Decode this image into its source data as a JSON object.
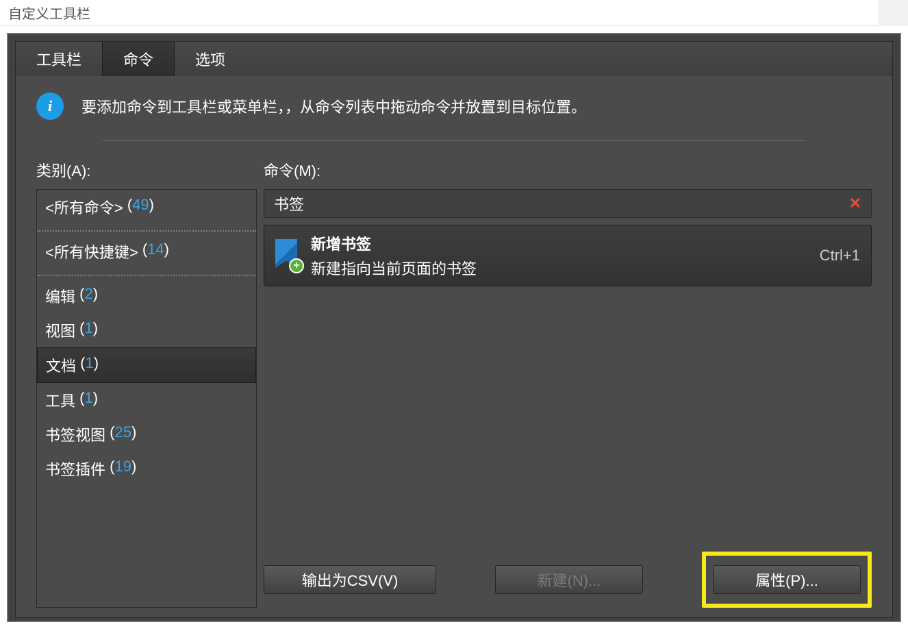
{
  "window": {
    "title": "自定义工具栏"
  },
  "tabs": [
    {
      "label": "工具栏"
    },
    {
      "label": "命令"
    },
    {
      "label": "选项"
    }
  ],
  "info": {
    "text": "要添加命令到工具栏或菜单栏，，从命令列表中拖动命令并放置到目标位置。"
  },
  "labels": {
    "category": "类别(A):",
    "command": "命令(M):"
  },
  "categories": [
    {
      "name": "<所有命令>",
      "count": "49",
      "divider": true
    },
    {
      "name": "<所有快捷键>",
      "count": "14",
      "divider": true
    },
    {
      "name": "编辑",
      "count": "2"
    },
    {
      "name": "视图",
      "count": "1"
    },
    {
      "name": "文档",
      "count": "1",
      "selected": true
    },
    {
      "name": "工具",
      "count": "1"
    },
    {
      "name": "书签视图",
      "count": "25"
    },
    {
      "name": "书签插件",
      "count": "19"
    }
  ],
  "search": {
    "value": "书签"
  },
  "commands": [
    {
      "title": "新增书签",
      "desc": "新建指向当前页面的书签",
      "shortcut": "Ctrl+1"
    }
  ],
  "buttons": {
    "csv": "输出为CSV(V)",
    "new": "新建(N)...",
    "props": "属性(P)..."
  }
}
